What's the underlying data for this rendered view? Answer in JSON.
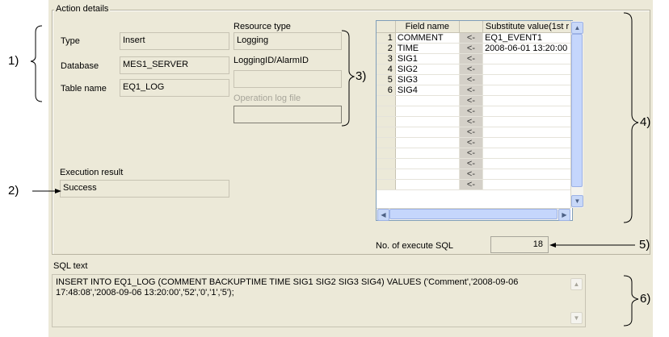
{
  "group_title": "Action details",
  "fields": {
    "type_label": "Type",
    "type_value": "Insert",
    "database_label": "Database",
    "database_value": "MES1_SERVER",
    "table_label": "Table name",
    "table_value": "EQ1_LOG"
  },
  "resource": {
    "type_label": "Resource type",
    "type_value": "Logging",
    "id_label": "LoggingID/AlarmID",
    "id_value": "",
    "oplog_label": "Operation log file",
    "oplog_value": ""
  },
  "execution": {
    "label": "Execution result",
    "value": "Success"
  },
  "grid": {
    "col_field": "Field name",
    "col_value": "Substitute value(1st r",
    "rows": [
      {
        "num": "1",
        "field": "COMMENT",
        "arrow": "<-",
        "value": "EQ1_EVENT1"
      },
      {
        "num": "2",
        "field": "TIME",
        "arrow": "<-",
        "value": "2008-06-01 13:20:00"
      },
      {
        "num": "3",
        "field": "SIG1",
        "arrow": "<-",
        "value": ""
      },
      {
        "num": "4",
        "field": "SIG2",
        "arrow": "<-",
        "value": ""
      },
      {
        "num": "5",
        "field": "SIG3",
        "arrow": "<-",
        "value": ""
      },
      {
        "num": "6",
        "field": "SIG4",
        "arrow": "<-",
        "value": ""
      },
      {
        "num": "",
        "field": "",
        "arrow": "<-",
        "value": ""
      },
      {
        "num": "",
        "field": "",
        "arrow": "<-",
        "value": ""
      },
      {
        "num": "",
        "field": "",
        "arrow": "<-",
        "value": ""
      },
      {
        "num": "",
        "field": "",
        "arrow": "<-",
        "value": ""
      },
      {
        "num": "",
        "field": "",
        "arrow": "<-",
        "value": ""
      },
      {
        "num": "",
        "field": "",
        "arrow": "<-",
        "value": ""
      },
      {
        "num": "",
        "field": "",
        "arrow": "<-",
        "value": ""
      },
      {
        "num": "",
        "field": "",
        "arrow": "<-",
        "value": ""
      },
      {
        "num": "",
        "field": "",
        "arrow": "<-",
        "value": ""
      }
    ]
  },
  "sql_count": {
    "label": "No. of execute SQL",
    "value": "18"
  },
  "sql": {
    "label": "SQL text",
    "text": "INSERT INTO EQ1_LOG (COMMENT BACKUPTIME TIME SIG1 SIG2 SIG3 SIG4) VALUES ('Comment','2008-09-06 17:48:08','2008-09-06 13:20:00','52','0','1','5');"
  },
  "callouts": {
    "c1": "1)",
    "c2": "2)",
    "c3": "3)",
    "c4": "4)",
    "c5": "5)",
    "c6": "6)"
  },
  "colors": {
    "panel": "#ece9d8",
    "scrollbar_accent": "#c5d6fc"
  }
}
